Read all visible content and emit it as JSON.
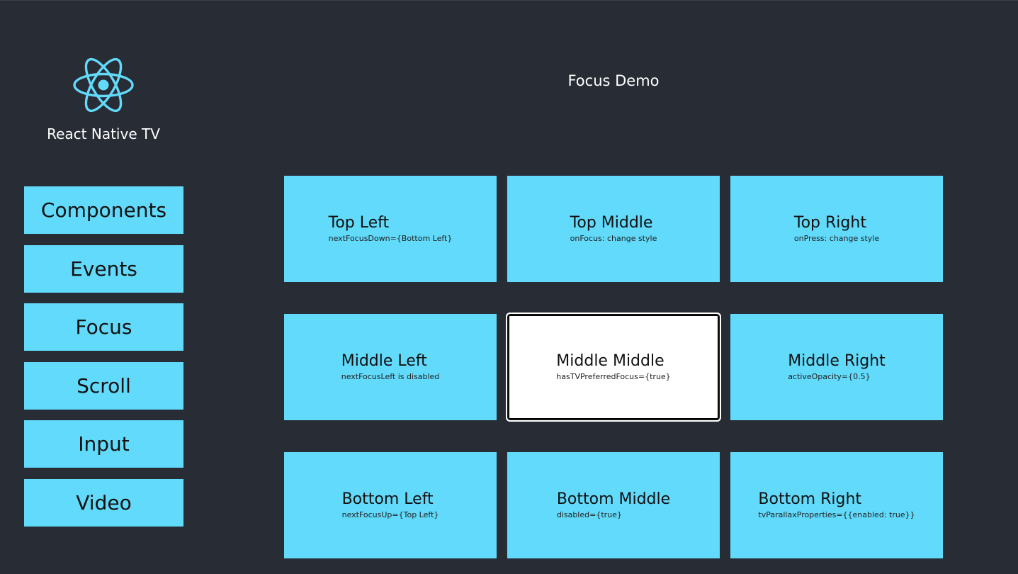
{
  "app": {
    "title": "React Native TV"
  },
  "colors": {
    "background": "#282c34",
    "accent": "#61dafb",
    "focused_tile": "#ffffff"
  },
  "sidebar": {
    "logo_icon": "react-logo-icon",
    "items": [
      {
        "label": "Components"
      },
      {
        "label": "Events"
      },
      {
        "label": "Focus"
      },
      {
        "label": "Scroll"
      },
      {
        "label": "Input"
      },
      {
        "label": "Video"
      }
    ]
  },
  "main": {
    "title": "Focus Demo",
    "tiles": [
      {
        "label": "Top Left",
        "description": "nextFocusDown={Bottom Left}"
      },
      {
        "label": "Top Middle",
        "description": "onFocus: change style"
      },
      {
        "label": "Top Right",
        "description": "onPress: change style"
      },
      {
        "label": "Middle Left",
        "description": "nextFocusLeft is disabled"
      },
      {
        "label": "Middle Middle",
        "description": "hasTVPreferredFocus={true}",
        "focused": true
      },
      {
        "label": "Middle Right",
        "description": "activeOpacity={0.5}"
      },
      {
        "label": "Bottom Left",
        "description": "nextFocusUp={Top Left}"
      },
      {
        "label": "Bottom Middle",
        "description": "disabled={true}"
      },
      {
        "label": "Bottom Right",
        "description": "tvParallaxProperties={{enabled: true}}"
      }
    ]
  }
}
